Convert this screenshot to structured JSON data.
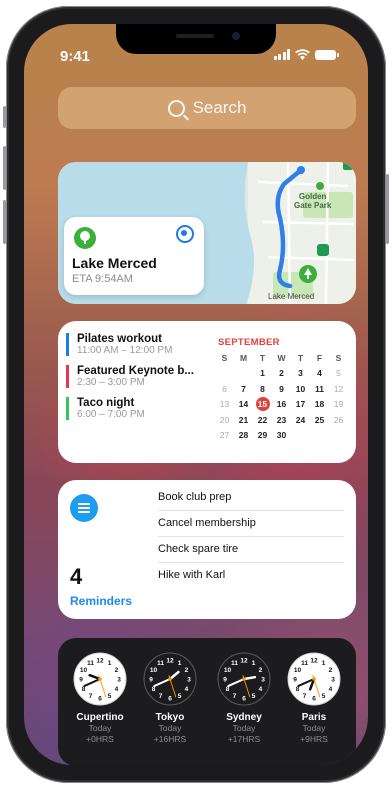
{
  "status": {
    "time": "9:41"
  },
  "search": {
    "label": "Search"
  },
  "maps": {
    "destination": "Lake Merced",
    "eta": "ETA 9:54AM",
    "park_label_1": "Golden",
    "park_label_2": "Gate Park",
    "lake_label": "Lake Merced"
  },
  "calendar": {
    "events": [
      {
        "title": "Pilates workout",
        "time": "11:00 AM – 12:00 PM",
        "color": "#1d7ce6"
      },
      {
        "title": "Featured Keynote b...",
        "time": "2:30 – 3:00 PM",
        "color": "#e8344e"
      },
      {
        "title": "Taco night",
        "time": "6:00 – 7:00 PM",
        "color": "#34c759"
      }
    ],
    "month": "SEPTEMBER",
    "weekdays": [
      "S",
      "M",
      "T",
      "W",
      "T",
      "F",
      "S"
    ],
    "weeks": [
      [
        "",
        "",
        "1",
        "2",
        "3",
        "4",
        "5"
      ],
      [
        "6",
        "7",
        "8",
        "9",
        "10",
        "11",
        "12"
      ],
      [
        "13",
        "14",
        "15",
        "16",
        "17",
        "18",
        "19"
      ],
      [
        "20",
        "21",
        "22",
        "23",
        "24",
        "25",
        "26"
      ],
      [
        "27",
        "28",
        "29",
        "30",
        "",
        "",
        ""
      ]
    ],
    "today": "15",
    "accent": "#e3403a"
  },
  "reminders": {
    "count": "4",
    "label": "Reminders",
    "items": [
      "Book club prep",
      "Cancel membership",
      "Check spare tire",
      "Hike with Karl"
    ]
  },
  "world_clock": [
    {
      "city": "Cupertino",
      "day": "Today",
      "offset": "+0HRS",
      "hour": 9,
      "minute": 41,
      "dark": false
    },
    {
      "city": "Tokyo",
      "day": "Today",
      "offset": "+16HRS",
      "hour": 1,
      "minute": 41,
      "dark": true
    },
    {
      "city": "Sydney",
      "day": "Today",
      "offset": "+17HRS",
      "hour": 2,
      "minute": 41,
      "dark": true
    },
    {
      "city": "Paris",
      "day": "Today",
      "offset": "+9HRS",
      "hour": 6,
      "minute": 41,
      "dark": false
    }
  ]
}
